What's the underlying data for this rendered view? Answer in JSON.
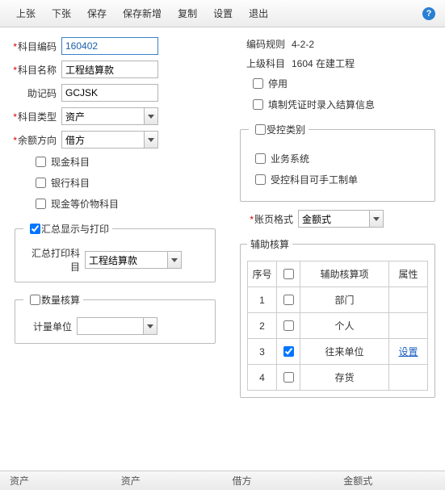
{
  "toolbar": {
    "items": [
      "上张",
      "下张",
      "保存",
      "保存新增",
      "复制",
      "设置",
      "退出"
    ]
  },
  "left": {
    "subject_code_label": "科目编码",
    "subject_code": "160402",
    "subject_name_label": "科目名称",
    "subject_name": "工程结算款",
    "mnemonic_label": "助记码",
    "mnemonic": "GCJSK",
    "subject_type_label": "科目类型",
    "subject_type": "资产",
    "balance_dir_label": "余额方向",
    "balance_dir": "借方",
    "cb_cash": "现金科目",
    "cb_bank": "银行科目",
    "cb_cash_eq": "现金等价物科目",
    "group_summary": "汇总显示与打印",
    "summary_subject_label": "汇总打印科目",
    "summary_subject": "工程结算款",
    "group_qty": "数量核算",
    "uom_label": "计量单位"
  },
  "right": {
    "coding_rule_label": "编码规则",
    "coding_rule": "4-2-2",
    "parent_label": "上级科目",
    "parent": "1604 在建工程",
    "cb_disabled": "停用",
    "cb_voucher_settle": "填制凭证时录入结算信息",
    "group_controlled": "受控类别",
    "cb_biz": "业务系统",
    "cb_manual": "受控科目可手工制单",
    "page_format_label": "账页格式",
    "page_format": "金额式",
    "group_aux": "辅助核算",
    "aux_cols": {
      "seq": "序号",
      "item": "辅助核算项",
      "attr": "属性"
    },
    "aux_rows": [
      {
        "n": "1",
        "checked": false,
        "item": "部门",
        "attr": ""
      },
      {
        "n": "2",
        "checked": false,
        "item": "个人",
        "attr": ""
      },
      {
        "n": "3",
        "checked": true,
        "item": "往来单位",
        "attr": "设置"
      },
      {
        "n": "4",
        "checked": false,
        "item": "存货",
        "attr": ""
      }
    ]
  },
  "footer": {
    "c1": "资产",
    "c2": "资产",
    "c3": "借方",
    "c4": "金额式"
  }
}
